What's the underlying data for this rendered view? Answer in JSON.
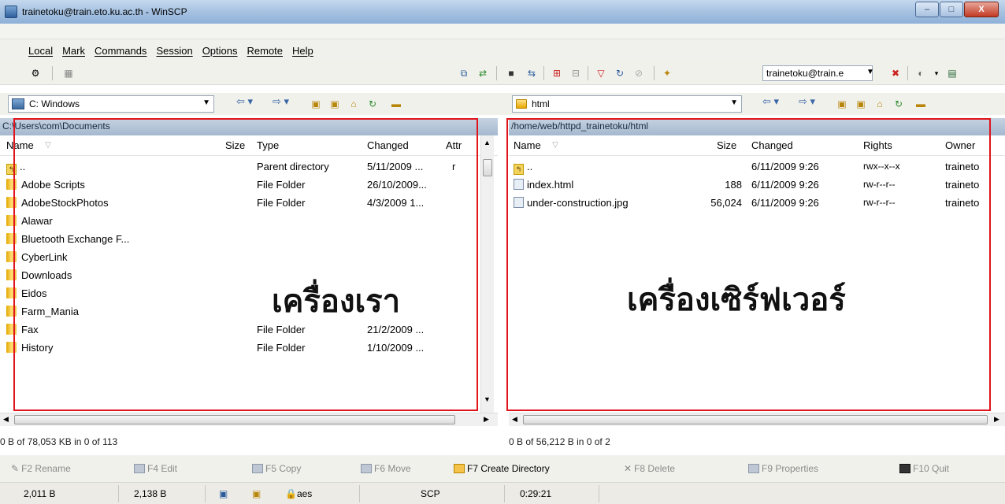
{
  "window": {
    "title": "trainetoku@train.eto.ku.ac.th - WinSCP",
    "buttons": [
      "–",
      "□",
      "X"
    ]
  },
  "menu": [
    "Local",
    "Mark",
    "Commands",
    "Session",
    "Options",
    "Remote",
    "Help"
  ],
  "toolbar": {
    "session_value": "trainetoku@train.e"
  },
  "local": {
    "drive": "C: Windows",
    "path": "C:\\Users\\com\\Documents",
    "columns": [
      "Name",
      "Size",
      "Type",
      "Changed",
      "Attr"
    ],
    "rows": [
      {
        "name": "..",
        "size": "",
        "type": "Parent directory",
        "changed": "5/11/2009 ...",
        "attr": "r",
        "icon": "up-dir-icon"
      },
      {
        "name": "Adobe Scripts",
        "size": "",
        "type": "File Folder",
        "changed": "26/10/2009...",
        "attr": "",
        "icon": "folder-icon"
      },
      {
        "name": "AdobeStockPhotos",
        "size": "",
        "type": "File Folder",
        "changed": "4/3/2009 1...",
        "attr": "",
        "icon": "folder-icon"
      },
      {
        "name": "Alawar",
        "size": "",
        "type": "",
        "changed": "",
        "attr": "",
        "icon": "folder-icon"
      },
      {
        "name": "Bluetooth Exchange F...",
        "size": "",
        "type": "",
        "changed": "",
        "attr": "",
        "icon": "folder-icon"
      },
      {
        "name": "CyberLink",
        "size": "",
        "type": "",
        "changed": "",
        "attr": "",
        "icon": "folder-icon"
      },
      {
        "name": "Downloads",
        "size": "",
        "type": "",
        "changed": "",
        "attr": "",
        "icon": "folder-icon"
      },
      {
        "name": "Eidos",
        "size": "",
        "type": "",
        "changed": "",
        "attr": "",
        "icon": "folder-icon"
      },
      {
        "name": "Farm_Mania",
        "size": "",
        "type": "",
        "changed": "",
        "attr": "",
        "icon": "folder-icon"
      },
      {
        "name": "Fax",
        "size": "",
        "type": "File Folder",
        "changed": "21/2/2009 ...",
        "attr": "",
        "icon": "folder-icon"
      },
      {
        "name": "History",
        "size": "",
        "type": "File Folder",
        "changed": "1/10/2009 ...",
        "attr": "",
        "icon": "folder-icon"
      }
    ],
    "annotation": "เครื่องเรา",
    "status": "0 B of 78,053 KB in 0 of 113"
  },
  "remote": {
    "dir": "html",
    "path": "/home/web/httpd_trainetoku/html",
    "columns": [
      "Name",
      "Size",
      "Changed",
      "Rights",
      "Owner"
    ],
    "rows": [
      {
        "name": "..",
        "size": "",
        "changed": "6/11/2009 9:26",
        "rights": "rwx--x--x",
        "owner": "traineto",
        "icon": "up-dir-icon"
      },
      {
        "name": "index.html",
        "size": "188",
        "changed": "6/11/2009 9:26",
        "rights": "rw-r--r--",
        "owner": "traineto",
        "icon": "html-file-icon"
      },
      {
        "name": "under-construction.jpg",
        "size": "56,024",
        "changed": "6/11/2009 9:26",
        "rights": "rw-r--r--",
        "owner": "traineto",
        "icon": "image-file-icon"
      }
    ],
    "annotation": "เครื่องเซิร์ฟเวอร์",
    "status": "0 B of 56,212 B in 0 of 2"
  },
  "fkeys": [
    "F2 Rename",
    "F4 Edit",
    "F5 Copy",
    "F6 Move",
    "F7 Create Directory",
    "F8 Delete",
    "F9 Properties",
    "F10 Quit"
  ],
  "bottom": {
    "sent": "2,011 B",
    "received": "2,138 B",
    "cipher": "aes",
    "protocol": "SCP",
    "time": "0:29:21"
  },
  "colors": {
    "annotation_border": "#e0141b",
    "path_bar": "#b3c3d6"
  }
}
